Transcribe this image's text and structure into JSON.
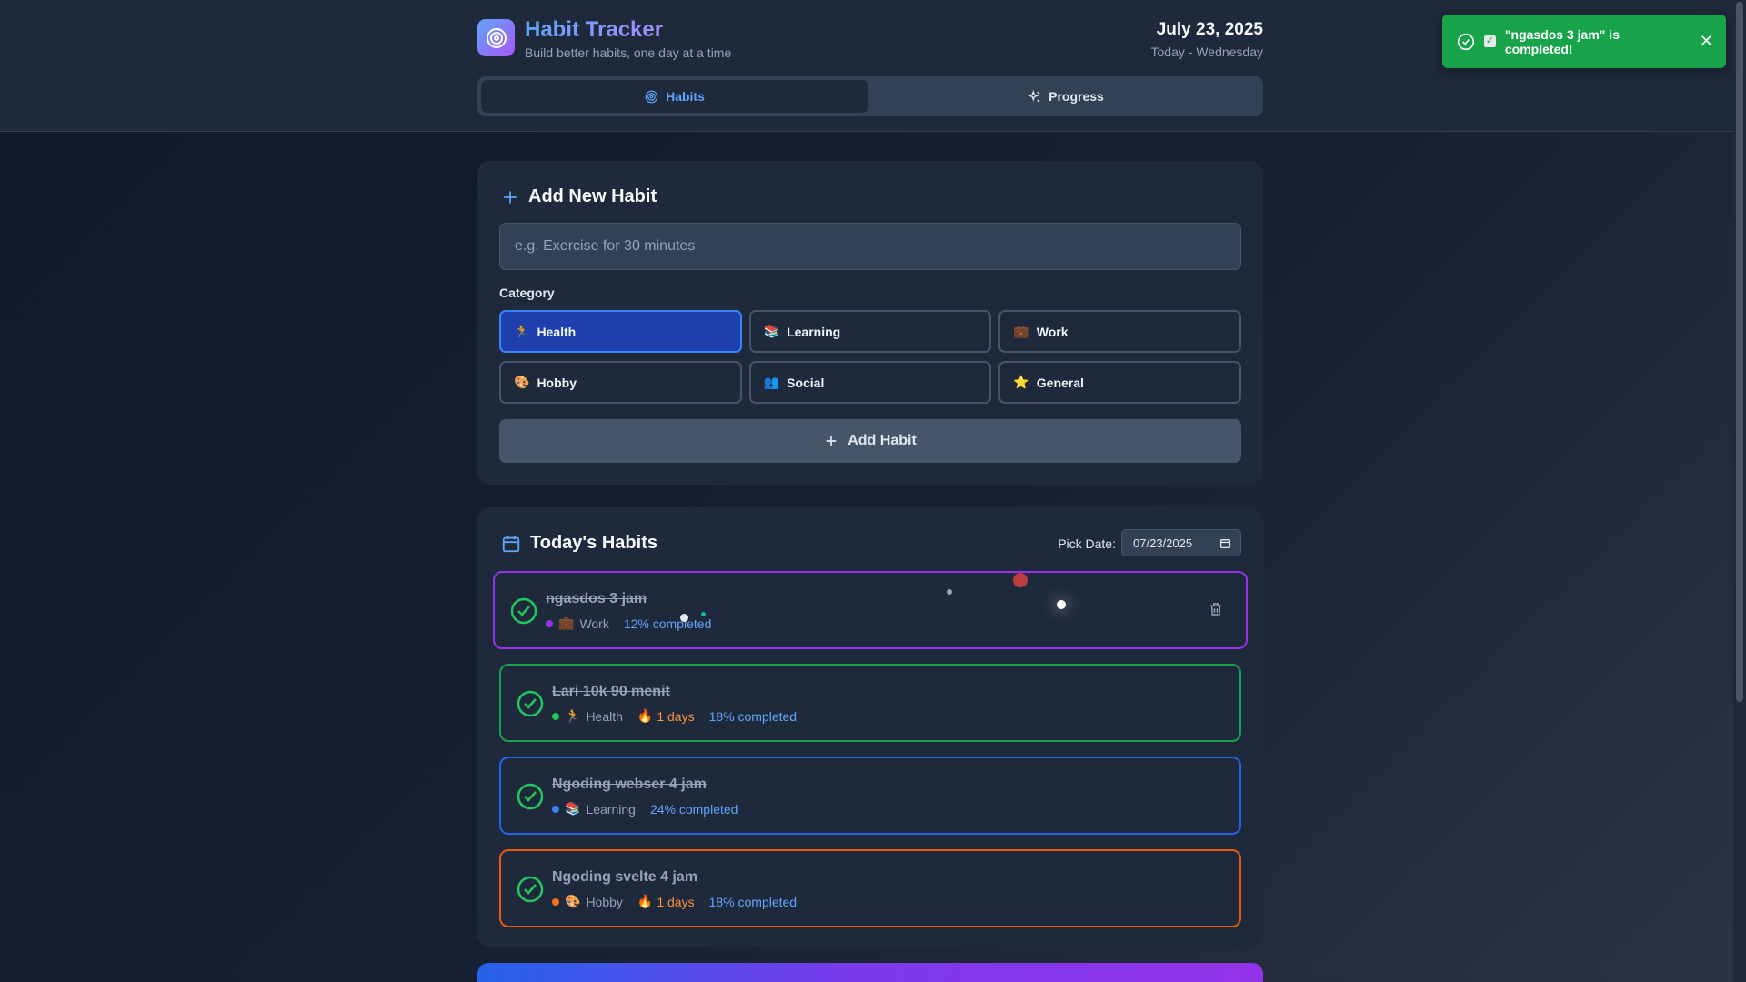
{
  "header": {
    "title": "Habit Tracker",
    "subtitle": "Build better habits, one day at a time",
    "date": "July 23, 2025",
    "day": "Today - Wednesday"
  },
  "tabs": [
    {
      "label": "Habits",
      "icon": "target-icon",
      "active": true
    },
    {
      "label": "Progress",
      "icon": "sparkles-icon",
      "active": false
    }
  ],
  "toast": {
    "message": "\"ngasdos 3 jam\" is completed!",
    "color": "#16a34a"
  },
  "add_form": {
    "title": "Add New Habit",
    "placeholder": "e.g. Exercise for 30 minutes",
    "value": "",
    "category_label": "Category",
    "categories": [
      {
        "label": "Health",
        "emoji": "🏃",
        "selected": true
      },
      {
        "label": "Learning",
        "emoji": "📚",
        "selected": false
      },
      {
        "label": "Work",
        "emoji": "💼",
        "selected": false
      },
      {
        "label": "Hobby",
        "emoji": "🎨",
        "selected": false
      },
      {
        "label": "Social",
        "emoji": "👥",
        "selected": false
      },
      {
        "label": "General",
        "emoji": "⭐",
        "selected": false
      }
    ],
    "submit_label": "Add Habit"
  },
  "today": {
    "title": "Today's Habits",
    "pick_date_label": "Pick Date:",
    "date_value": "07/23/2025",
    "habits": [
      {
        "name": "ngasdos 3 jam",
        "category": "Work",
        "emoji": "💼",
        "dot": "#9333ea",
        "border": "#9333ea",
        "streak": "",
        "progress": "12% completed",
        "completed": true
      },
      {
        "name": "Lari 10k 90 menit",
        "category": "Health",
        "emoji": "🏃",
        "dot": "#22c55e",
        "border": "#16a34a",
        "streak": "1 days",
        "progress": "18% completed",
        "completed": true
      },
      {
        "name": "Ngoding webser 4 jam",
        "category": "Learning",
        "emoji": "📚",
        "dot": "#3b82f6",
        "border": "#2563eb",
        "streak": "",
        "progress": "24% completed",
        "completed": true
      },
      {
        "name": "Ngoding svelte 4 jam",
        "category": "Hobby",
        "emoji": "🎨",
        "dot": "#f97316",
        "border": "#ea580c",
        "streak": "1 days",
        "progress": "18% completed",
        "completed": true
      }
    ]
  }
}
